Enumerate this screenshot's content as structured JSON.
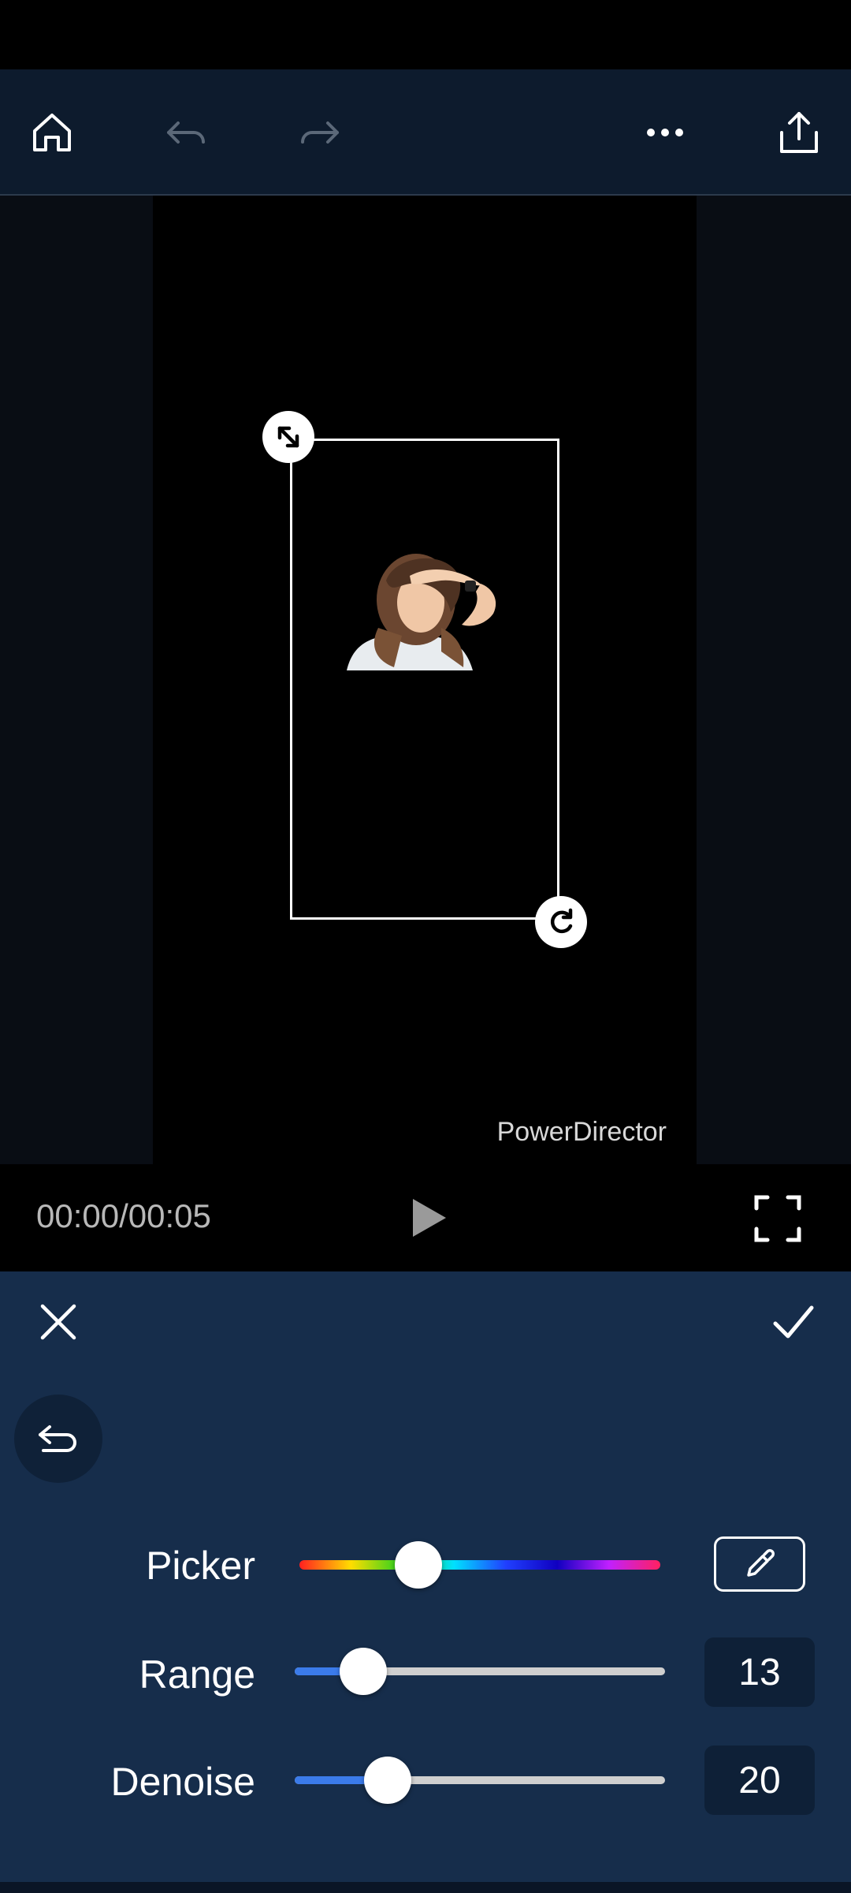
{
  "toolbar": {
    "home_icon": "home-icon",
    "undo_icon": "undo-icon",
    "redo_icon": "redo-icon",
    "more_icon": "more-icon",
    "export_icon": "share-icon"
  },
  "preview": {
    "watermark": "PowerDirector"
  },
  "playback": {
    "time": "00:00/00:05"
  },
  "panel": {
    "picker_label": "Picker",
    "picker_hue_fraction": 0.33,
    "range_label": "Range",
    "range_value": "13",
    "range_fraction": 0.13,
    "denoise_label": "Denoise",
    "denoise_value": "20",
    "denoise_fraction": 0.2
  },
  "colors": {
    "toolbar_bg": "#0d1b2d",
    "panel_bg": "#162d4b",
    "slider_fill": "#3b7bea"
  }
}
